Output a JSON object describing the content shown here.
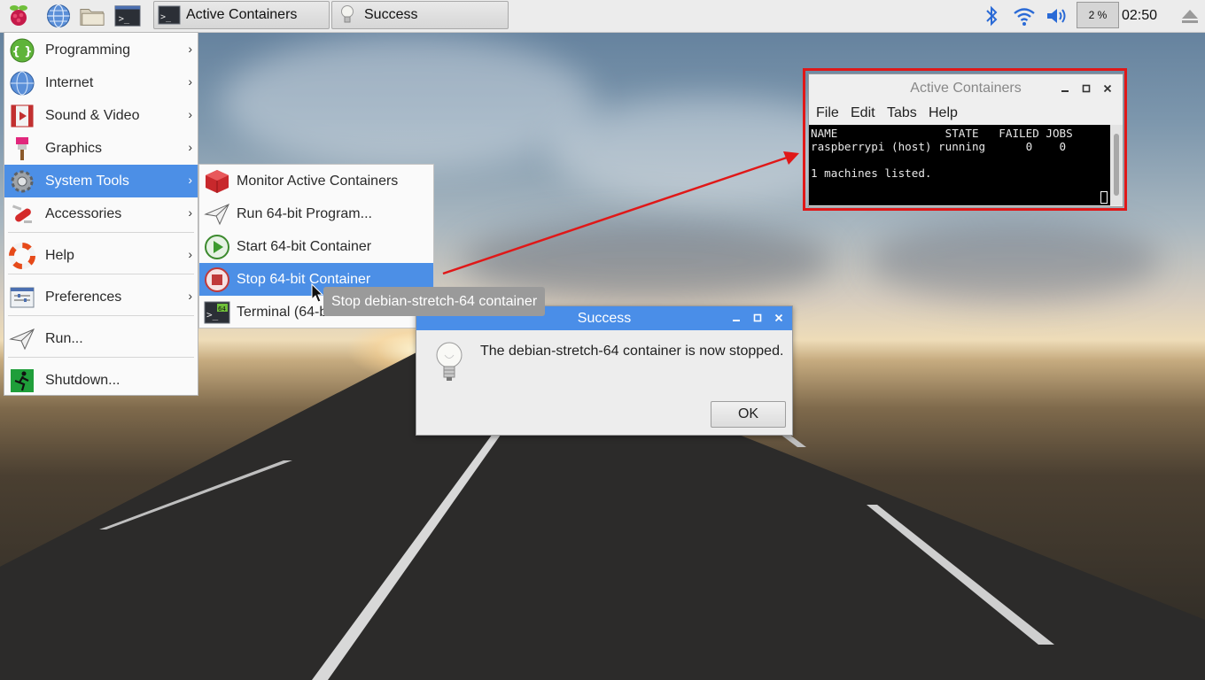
{
  "taskbar": {
    "menu_button_icon": "raspberry-pi-logo",
    "launchers": [
      "web-browser",
      "file-manager",
      "terminal"
    ],
    "tasks": [
      {
        "label": "Active Containers",
        "icon": "terminal-icon"
      },
      {
        "label": "Success",
        "icon": "lightbulb-icon"
      }
    ],
    "tray": {
      "bluetooth_icon": "bluetooth-icon",
      "wifi_icon": "wifi-icon",
      "volume_icon": "volume-icon",
      "cpu_percent": "2 %",
      "clock": "02:50",
      "eject_icon": "eject-icon"
    }
  },
  "menu": {
    "items": [
      {
        "label": "Programming",
        "icon": "programming-icon"
      },
      {
        "label": "Internet",
        "icon": "globe-icon"
      },
      {
        "label": "Sound & Video",
        "icon": "film-icon"
      },
      {
        "label": "Graphics",
        "icon": "paintbrush-icon"
      },
      {
        "label": "System Tools",
        "icon": "gear-icon",
        "active": true
      },
      {
        "label": "Accessories",
        "icon": "swiss-knife-icon"
      },
      {
        "label": "Help",
        "icon": "lifebuoy-icon"
      },
      {
        "label": "Preferences",
        "icon": "preferences-icon"
      },
      {
        "label": "Run...",
        "icon": "paper-plane-icon"
      },
      {
        "label": "Shutdown...",
        "icon": "exit-icon"
      }
    ]
  },
  "submenu": {
    "items": [
      {
        "label": "Monitor Active Containers",
        "icon": "red-cube-icon"
      },
      {
        "label": "Run 64-bit Program...",
        "icon": "paper-plane-icon"
      },
      {
        "label": "Start 64-bit Container",
        "icon": "play-icon"
      },
      {
        "label": "Stop 64-bit Container",
        "icon": "stop-icon",
        "active": true
      },
      {
        "label": "Terminal (64-b",
        "icon": "terminal-64-icon"
      }
    ]
  },
  "tooltip": {
    "text": "Stop debian-stretch-64 container"
  },
  "dialog": {
    "title": "Success",
    "message": "The debian-stretch-64 container is now stopped.",
    "ok_label": "OK"
  },
  "terminal": {
    "title": "Active Containers",
    "menu": [
      "File",
      "Edit",
      "Tabs",
      "Help"
    ],
    "output": "NAME                STATE   FAILED JOBS\nraspberrypi (host) running      0    0\n\n1 machines listed."
  },
  "colors": {
    "menu_highlight": "#4c8fe6",
    "dialog_titlebar": "#4a8ee8",
    "annotation_red": "#e01818"
  }
}
